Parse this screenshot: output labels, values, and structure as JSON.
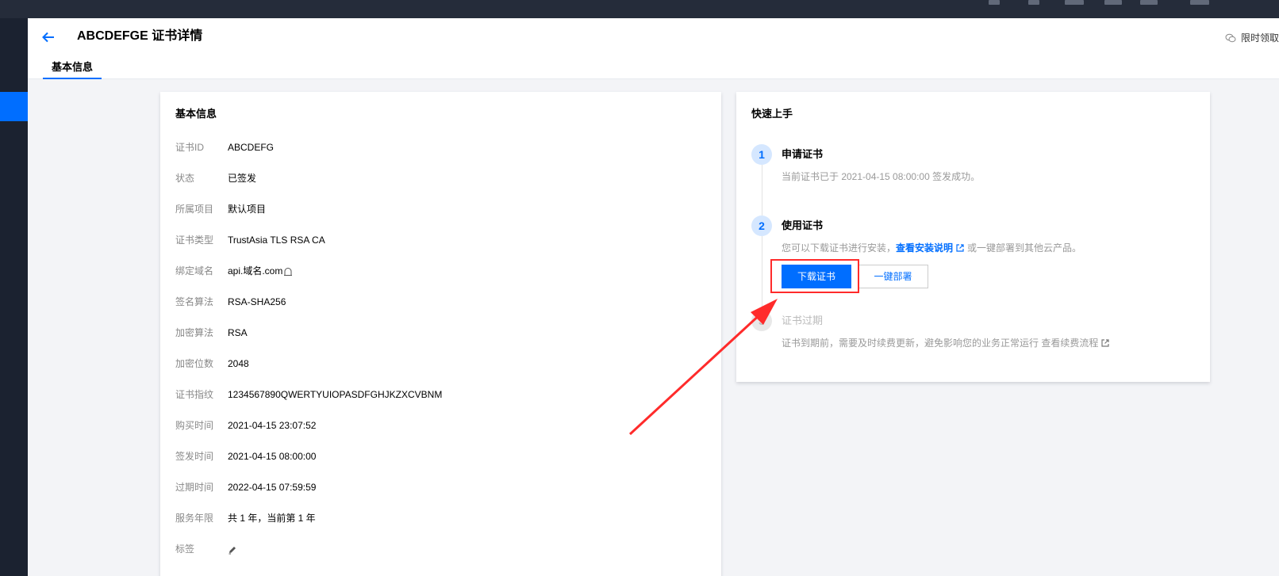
{
  "header": {
    "title": "ABCDEFGE 证书详情",
    "promo_label": "限时领取",
    "tab_basic": "基本信息"
  },
  "basic_info": {
    "title": "基本信息",
    "rows": [
      {
        "label": "证书ID",
        "value": "ABCDEFG"
      },
      {
        "label": "状态",
        "value": "已签发"
      },
      {
        "label": "所属项目",
        "value": "默认项目"
      },
      {
        "label": "证书类型",
        "value": "TrustAsia TLS RSA CA"
      },
      {
        "label": "绑定域名",
        "value": "api.域名.com"
      },
      {
        "label": "签名算法",
        "value": "RSA-SHA256"
      },
      {
        "label": "加密算法",
        "value": "RSA"
      },
      {
        "label": "加密位数",
        "value": "2048"
      },
      {
        "label": "证书指纹",
        "value": "1234567890QWERTYUIOPASDFGHJKZXCVBNM"
      },
      {
        "label": "购买时间",
        "value": "2021-04-15 23:07:52"
      },
      {
        "label": "签发时间",
        "value": "2021-04-15 08:00:00"
      },
      {
        "label": "过期时间",
        "value": "2022-04-15 07:59:59"
      },
      {
        "label": "服务年限",
        "value": "共 1 年，当前第 1 年"
      },
      {
        "label": "标签",
        "value": ""
      }
    ]
  },
  "quick_start": {
    "title": "快速上手",
    "steps": [
      {
        "num": "1",
        "title": "申请证书",
        "desc": "当前证书已于 2021-04-15 08:00:00 签发成功。"
      },
      {
        "num": "2",
        "title": "使用证书",
        "desc_pre": "您可以下载证书进行安装，",
        "link": "查看安装说明",
        "desc_post": "或一键部署到其他云产品。"
      },
      {
        "num": "3",
        "title": "证书过期",
        "desc": "证书到期前，需要及时续费更新，避免影响您的业务正常运行 查看续费流程"
      }
    ],
    "download_button": "下载证书",
    "deploy_button": "一键部署"
  },
  "colors": {
    "accent": "#006eff",
    "highlight": "#ff2b2b"
  }
}
